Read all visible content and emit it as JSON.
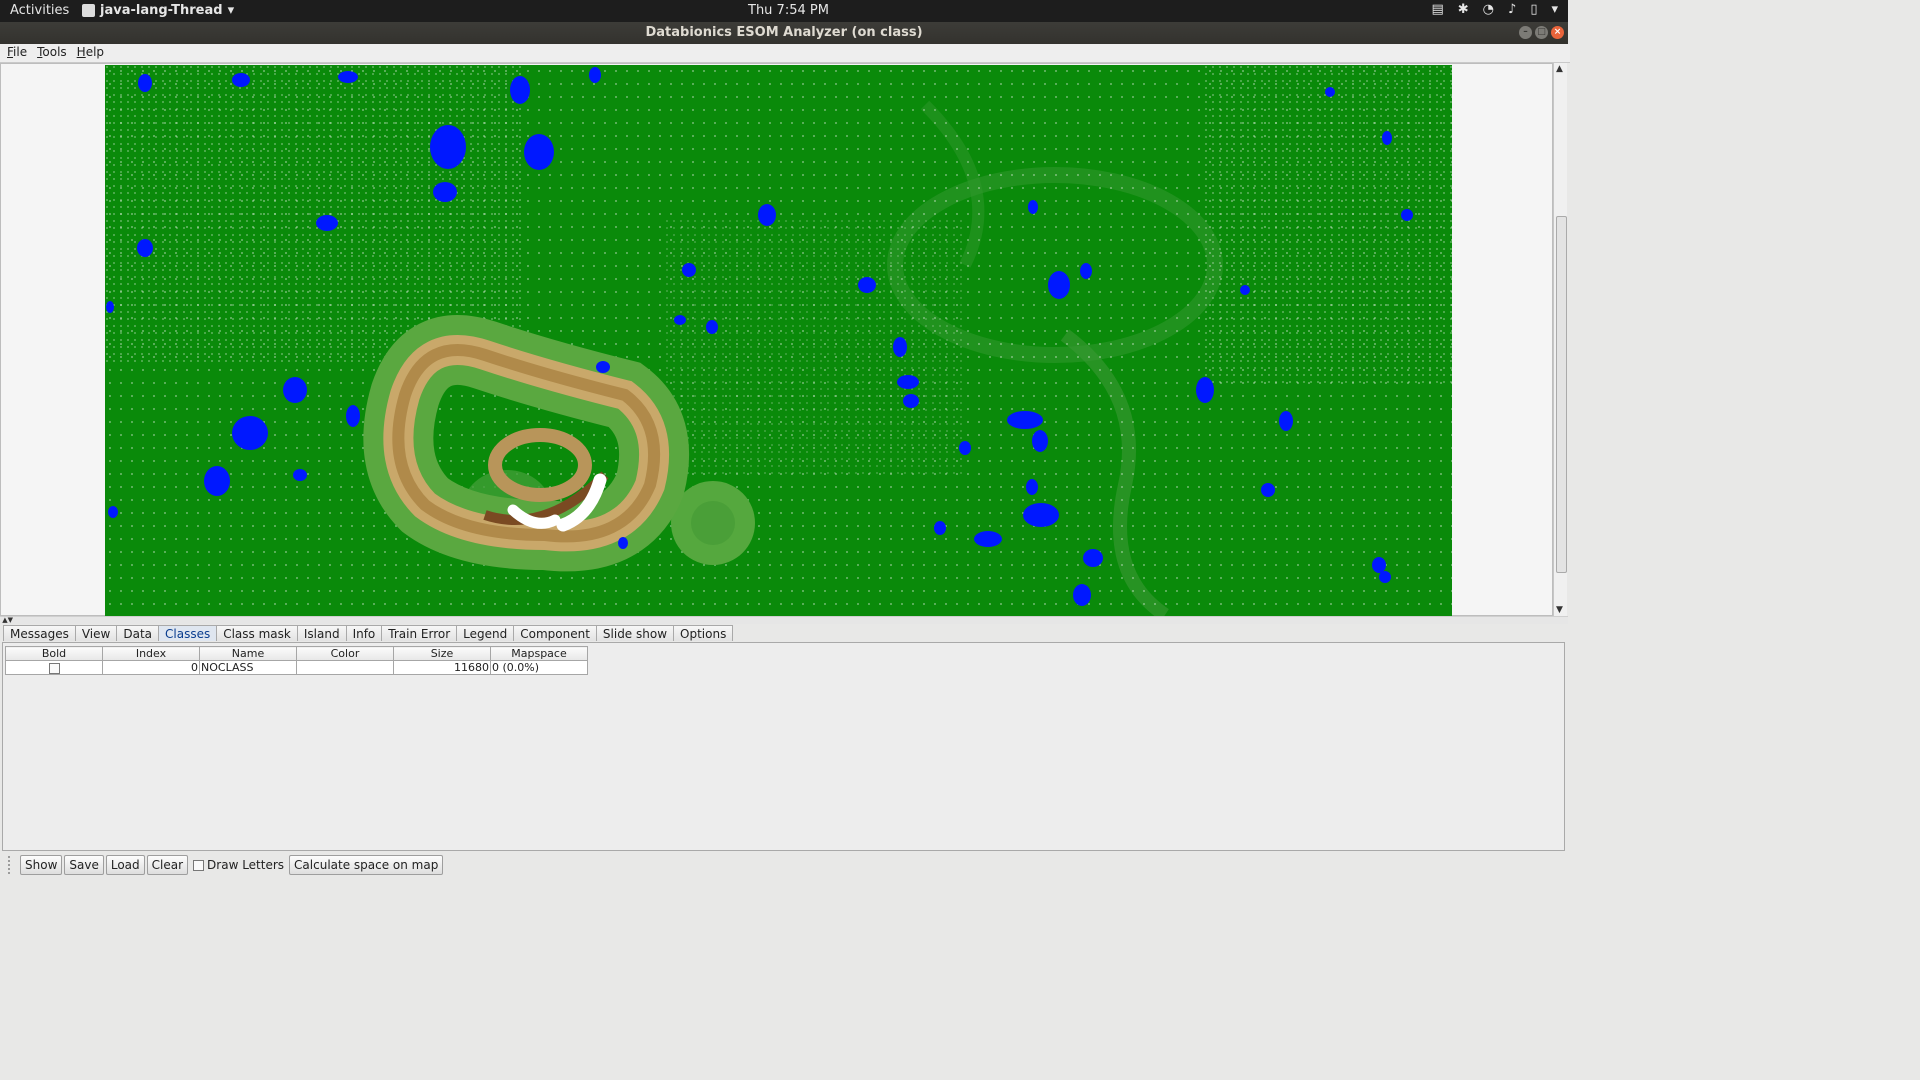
{
  "topbar": {
    "activities": "Activities",
    "app_name": "java-lang-Thread",
    "clock": "Thu  7:54 PM"
  },
  "window": {
    "title": "Databionics ESOM Analyzer (on class)"
  },
  "menu": [
    "File",
    "Tools",
    "Help"
  ],
  "tabs": [
    "Messages",
    "View",
    "Data",
    "Classes",
    "Class mask",
    "Island",
    "Info",
    "Train Error",
    "Legend",
    "Component",
    "Slide show",
    "Options"
  ],
  "selected_tab": "Classes",
  "table": {
    "headers": [
      "Bold",
      "Index",
      "Name",
      "Color",
      "Size",
      "Mapspace"
    ],
    "rows": [
      {
        "bold": false,
        "index": "0",
        "name": "NOCLASS",
        "color": "",
        "size": "11680",
        "mapspace": "0 (0.0%)"
      }
    ]
  },
  "toolbar": {
    "show": "Show",
    "save": "Save",
    "load": "Load",
    "clear": "Clear",
    "draw_letters": "Draw Letters",
    "calculate": "Calculate space on map"
  },
  "map_colors": {
    "green": "#0a8a0a",
    "blue": "#0018ff",
    "ridge_light": "#c9a86a",
    "ridge_dark": "#8a5a2a"
  }
}
